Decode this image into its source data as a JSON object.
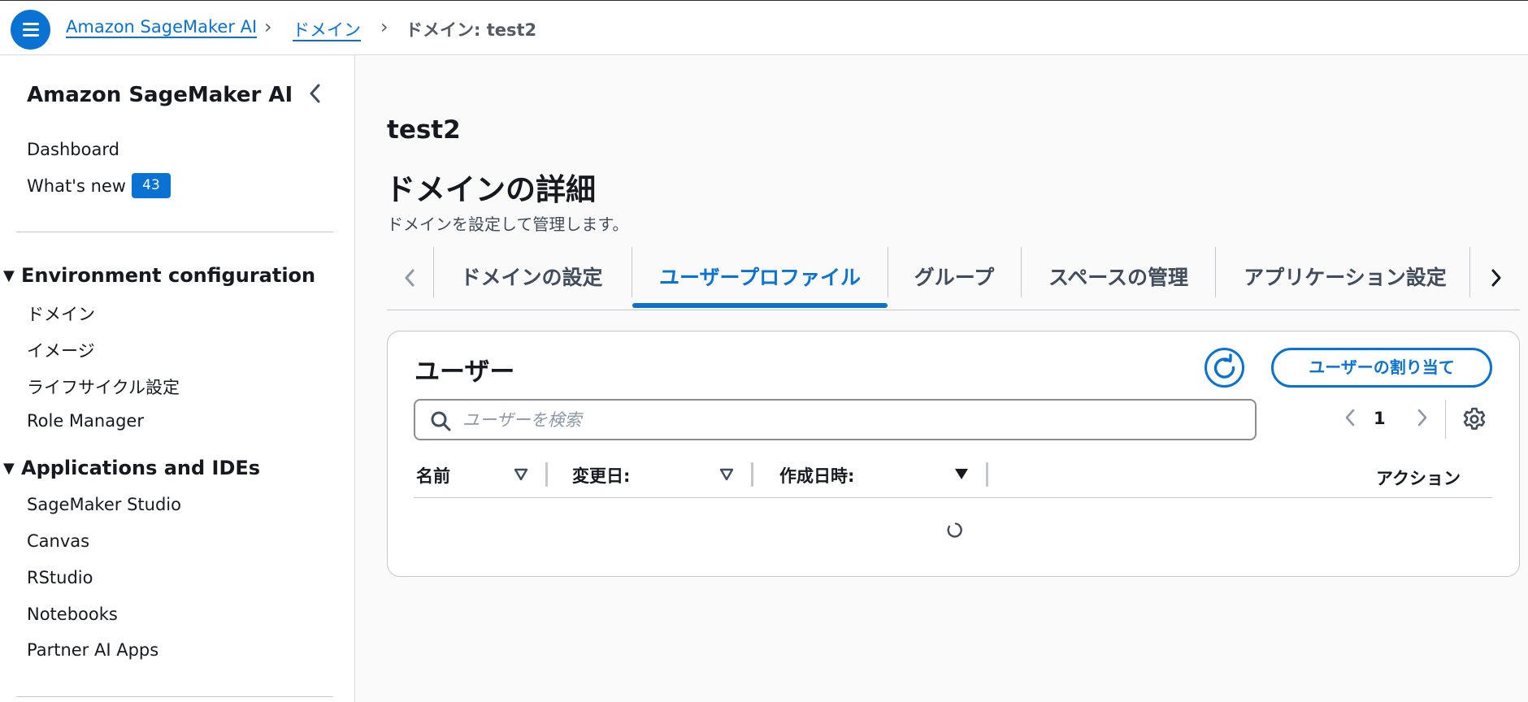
{
  "topbar": {
    "breadcrumbs": [
      {
        "label": "Amazon SageMaker AI"
      },
      {
        "label": "ドメイン"
      },
      {
        "label": "ドメイン: test2"
      }
    ]
  },
  "sidebar": {
    "title": "Amazon SageMaker AI",
    "top_links": [
      {
        "label": "Dashboard"
      },
      {
        "label": "What's new",
        "badge": "43"
      }
    ],
    "sections": [
      {
        "title": "Environment configuration",
        "items": [
          "ドメイン",
          "イメージ",
          "ライフサイクル設定",
          "Role Manager"
        ]
      },
      {
        "title": "Applications and IDEs",
        "items": [
          "SageMaker Studio",
          "Canvas",
          "RStudio",
          "Notebooks",
          "Partner AI Apps"
        ]
      }
    ]
  },
  "main": {
    "name": "test2",
    "header": "ドメインの詳細",
    "description": "ドメインを設定して管理します。",
    "tabs": [
      {
        "label": "ドメインの設定",
        "active": false
      },
      {
        "label": "ユーザープロファイル",
        "active": true
      },
      {
        "label": "グループ",
        "active": false
      },
      {
        "label": "スペースの管理",
        "active": false
      },
      {
        "label": "アプリケーション設定",
        "active": false
      }
    ],
    "users": {
      "title": "ユーザー",
      "assign_label": "ユーザーの割り当て",
      "search_placeholder": "ユーザーを検索",
      "current_page": "1",
      "columns": [
        {
          "label": "名前"
        },
        {
          "label": "変更日:"
        },
        {
          "label": "作成日時:"
        },
        {
          "label": "アクション"
        }
      ]
    }
  },
  "colors": {
    "accent": "#0972d3",
    "text": "#16191f",
    "muted": "#8d99a8"
  }
}
